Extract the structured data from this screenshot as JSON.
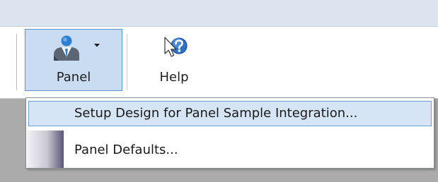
{
  "ribbon": {
    "panel_label": "Panel",
    "help_label": "Help",
    "panel_icon": "person-icon",
    "help_icon": "help-question-icon"
  },
  "menu": {
    "items": [
      {
        "label": "Setup Design for Panel Sample Integration...",
        "highlighted": true
      },
      {
        "label": "Panel Defaults...",
        "highlighted": false
      }
    ]
  },
  "colors": {
    "accent_border": "#5c8fcd",
    "accent_fill": "#c9dcf2",
    "help_icon_blue": "#2f73c9"
  }
}
